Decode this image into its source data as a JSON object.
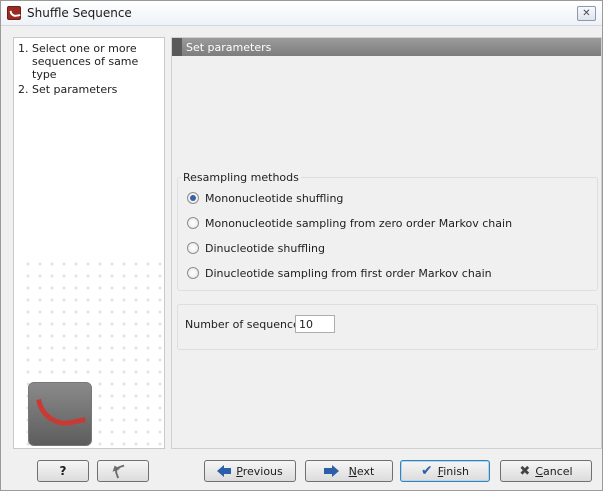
{
  "window": {
    "title": "Shuffle Sequence",
    "close_glyph": "✕"
  },
  "steps": [
    {
      "num": "1.",
      "label": "Select one or more sequences of same type"
    },
    {
      "num": "2.",
      "label": "Set parameters"
    }
  ],
  "main": {
    "section_title": "Set parameters",
    "resampling": {
      "title": "Resampling methods",
      "options": [
        {
          "label": "Mononucleotide shuffling",
          "checked": true
        },
        {
          "label": "Mononucleotide sampling from zero order Markov chain",
          "checked": false
        },
        {
          "label": "Dinucleotide shuffling",
          "checked": false
        },
        {
          "label": "Dinucleotide sampling from first order Markov chain",
          "checked": false
        }
      ]
    },
    "count": {
      "label": "Number of sequences:",
      "value": "10"
    }
  },
  "buttons": {
    "help": "?",
    "previous_accel": "P",
    "previous_rest": "revious",
    "next_accel": "N",
    "next_rest": "ext",
    "finish_accel": "F",
    "finish_rest": "inish",
    "cancel_accel": "C",
    "cancel_rest": "ancel"
  },
  "colors": {
    "accent": "#2d5fa8",
    "logo_red": "#c93a35",
    "header_gray": "#8c8c8c"
  },
  "icons": {
    "app": "clc-logo-icon",
    "undo": "undo-icon",
    "previous": "arrow-left-icon",
    "next": "arrow-right-icon",
    "finish": "checkmark-icon",
    "cancel": "x-icon"
  }
}
